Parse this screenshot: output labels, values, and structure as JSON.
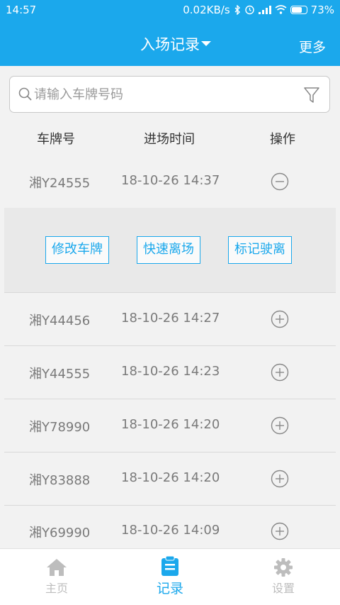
{
  "status_bar": {
    "time": "14:57",
    "net_speed": "0.02KB/s",
    "battery": "73%",
    "battery_level": 0.73
  },
  "header": {
    "title": "入场记录",
    "more_label": "更多"
  },
  "search": {
    "placeholder": "请输入车牌号码"
  },
  "table": {
    "headers": {
      "plate": "车牌号",
      "time": "进场时间",
      "op": "操作"
    },
    "rows": [
      {
        "plate": "湘Y24555",
        "time": "18-10-26 14:37",
        "op_icon": "minus-circle-icon",
        "expanded": true
      },
      {
        "plate": "湘Y44456",
        "time": "18-10-26 14:27",
        "op_icon": "plus-circle-icon",
        "expanded": false
      },
      {
        "plate": "湘Y44555",
        "time": "18-10-26 14:23",
        "op_icon": "plus-circle-icon",
        "expanded": false
      },
      {
        "plate": "湘Y78990",
        "time": "18-10-26 14:20",
        "op_icon": "plus-circle-icon",
        "expanded": false
      },
      {
        "plate": "湘Y83888",
        "time": "18-10-26 14:20",
        "op_icon": "plus-circle-icon",
        "expanded": false
      },
      {
        "plate": "湘Y69990",
        "time": "18-10-26 14:09",
        "op_icon": "plus-circle-icon",
        "expanded": false
      }
    ]
  },
  "row_actions": {
    "edit_plate": "修改车牌",
    "quick_exit": "快速离场",
    "mark_exit": "标记驶离"
  },
  "nav": {
    "home": "主页",
    "records": "记录",
    "settings": "设置"
  },
  "colors": {
    "accent": "#1ba8ec",
    "inactive": "#bdbdbd"
  }
}
